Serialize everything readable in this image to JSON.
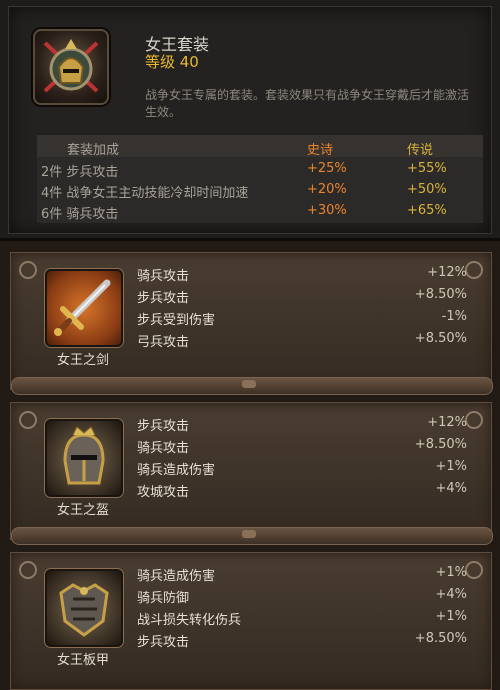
{
  "set": {
    "title": "女王套装",
    "level": "等级 40",
    "description": "战争女王专属的套装。套装效果只有战争女王穿戴后才能激活生效。",
    "bonus_header": {
      "label": "套装加成",
      "epic": "史诗",
      "legendary": "传说"
    },
    "bonuses": [
      {
        "label": "2件 步兵攻击",
        "epic": "+25%",
        "legendary": "+55%"
      },
      {
        "label": "4件 战争女王主动技能冷却时间加速",
        "epic": "+20%",
        "legendary": "+50%"
      },
      {
        "label": "6件 骑兵攻击",
        "epic": "+30%",
        "legendary": "+65%"
      }
    ]
  },
  "items": [
    {
      "name": "女王之剑",
      "icon": "sword-icon",
      "stats": [
        {
          "label": "骑兵攻击",
          "value": "+12%"
        },
        {
          "label": "步兵攻击",
          "value": "+8.50%"
        },
        {
          "label": "步兵受到伤害",
          "value": "-1%"
        },
        {
          "label": "弓兵攻击",
          "value": "+8.50%"
        }
      ]
    },
    {
      "name": "女王之盔",
      "icon": "helmet-icon",
      "stats": [
        {
          "label": "步兵攻击",
          "value": "+12%"
        },
        {
          "label": "骑兵攻击",
          "value": "+8.50%"
        },
        {
          "label": "骑兵造成伤害",
          "value": "+1%"
        },
        {
          "label": "攻城攻击",
          "value": "+4%"
        }
      ]
    },
    {
      "name": "女王板甲",
      "icon": "armor-icon",
      "stats": [
        {
          "label": "骑兵造成伤害",
          "value": "+1%"
        },
        {
          "label": "骑兵防御",
          "value": "+4%"
        },
        {
          "label": "战斗损失转化伤兵",
          "value": "+1%"
        },
        {
          "label": "步兵攻击",
          "value": "+8.50%"
        }
      ]
    }
  ],
  "colors": {
    "level": "#e8b830",
    "epic": "#e8842c",
    "legendary": "#d9b23a"
  }
}
